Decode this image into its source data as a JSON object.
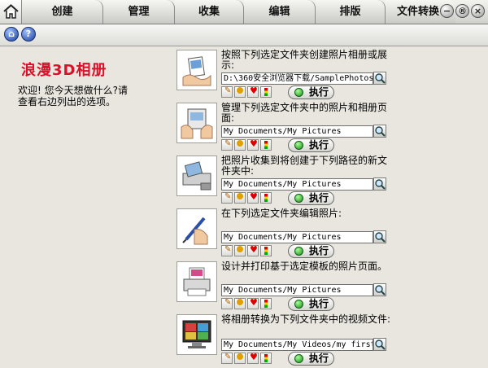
{
  "tabs": {
    "create": "创建",
    "manage": "管理",
    "collect": "收集",
    "edit": "编辑",
    "layout": "排版",
    "convert": "文件转换"
  },
  "app_title": "浪漫3D相册",
  "welcome": "欢迎! 您今天想做什么?请查看右边列出的选项。",
  "exec_label": "执行",
  "rows": [
    {
      "desc": "按照下列选定文件夹创建照片相册或展示:",
      "path": "D:\\360安全浏览器下载/SamplePhotos"
    },
    {
      "desc": "管理下列选定文件夹中的照片和相册页面:",
      "path": "My Documents/My Pictures"
    },
    {
      "desc": "把照片收集到将创建于下列路径的新文件夹中:",
      "path": "My Documents/My Pictures"
    },
    {
      "desc": "在下列选定文件夹编辑照片:",
      "path": "My Documents/My Pictures"
    },
    {
      "desc": "设计并打印基于选定模板的照片页面。",
      "path": "My Documents/My Pictures"
    },
    {
      "desc": "将相册转换为下列文件夹中的视频文件:",
      "path": "My Documents/My Videos/my first video"
    }
  ]
}
